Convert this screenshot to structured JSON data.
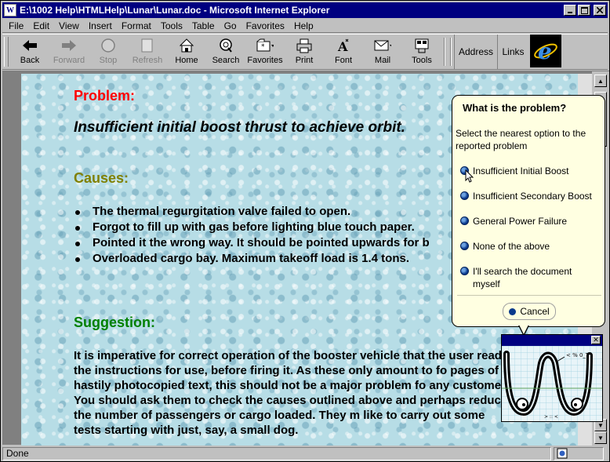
{
  "window": {
    "title": "E:\\1002 Help\\HTMLHelp\\Lunar\\Lunar.doc - Microsoft Internet Explorer"
  },
  "menu": [
    "File",
    "Edit",
    "View",
    "Insert",
    "Format",
    "Tools",
    "Table",
    "Go",
    "Favorites",
    "Help"
  ],
  "toolbar": {
    "back": "Back",
    "forward": "Forward",
    "stop": "Stop",
    "refresh": "Refresh",
    "home": "Home",
    "search": "Search",
    "favorites": "Favorites",
    "print": "Print",
    "font": "Font",
    "mail": "Mail",
    "tools": "Tools",
    "address": "Address",
    "links": "Links"
  },
  "document": {
    "problem_heading": "Problem:",
    "problem_text": "Insufficient initial boost thrust to achieve orbit.",
    "causes_heading": "Causes:",
    "causes": [
      "The thermal regurgitation valve failed to open.",
      "Forgot to fill up with gas before lighting blue touch paper.",
      "Pointed it the wrong way. It should be pointed upwards for b",
      "Overloaded cargo bay. Maximum takeoff load is 1.4 tons."
    ],
    "suggestion_heading": "Suggestion:",
    "suggestion_text": "It is imperative for correct operation of the booster vehicle that the user reads the instructions for use, before firing it. As these only amount to fo pages of hastily photocopied text, this should not be a major problem fo any customer. You should ask them to check the causes outlined above and perhaps reduce the number of passengers or cargo loaded. They m like to carry out some tests starting with just, say, a small dog."
  },
  "assistant_balloon": {
    "title": "What is the problem?",
    "description": "Select the nearest option to the reported problem",
    "options": [
      "Insufficient Initial Boost",
      "Insufficient Secondary Boost",
      "General Power Failure",
      "None of the above",
      "I'll search the document myself"
    ],
    "cancel": "Cancel"
  },
  "status": {
    "text": "Done"
  },
  "colors": {
    "titlebar": "#000080",
    "problem": "#ff0000",
    "causes": "#808000",
    "suggestion": "#008000",
    "balloon": "#ffffe1"
  }
}
